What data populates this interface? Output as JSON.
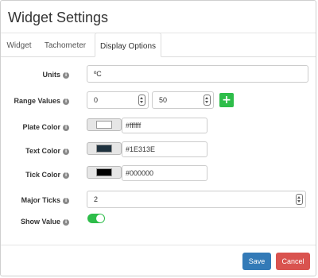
{
  "dialog": {
    "title": "Widget Settings"
  },
  "tabs": [
    {
      "label": "Widget",
      "active": false
    },
    {
      "label": "Tachometer",
      "active": false
    },
    {
      "label": "Display Options",
      "active": true
    }
  ],
  "form": {
    "units": {
      "label": "Units",
      "value": "ºC"
    },
    "range": {
      "label": "Range Values",
      "min": "0",
      "max": "50",
      "add_icon": "plus-icon"
    },
    "plate_color": {
      "label": "Plate Color",
      "hex": "#ffffff",
      "swatch": "#ffffff"
    },
    "text_color": {
      "label": "Text Color",
      "hex": "#1E313E",
      "swatch": "#1e313e"
    },
    "tick_color": {
      "label": "Tick Color",
      "hex": "#000000",
      "swatch": "#000000"
    },
    "major_ticks": {
      "label": "Major Ticks",
      "value": "2"
    },
    "show_value": {
      "label": "Show Value",
      "on": true
    }
  },
  "info_glyph": "i",
  "footer": {
    "save_label": "Save",
    "cancel_label": "Cancel"
  },
  "colors": {
    "save": "#337ab7",
    "cancel": "#d9534f",
    "toggle_on": "#2ebd4a",
    "add": "#2ebd4a"
  }
}
